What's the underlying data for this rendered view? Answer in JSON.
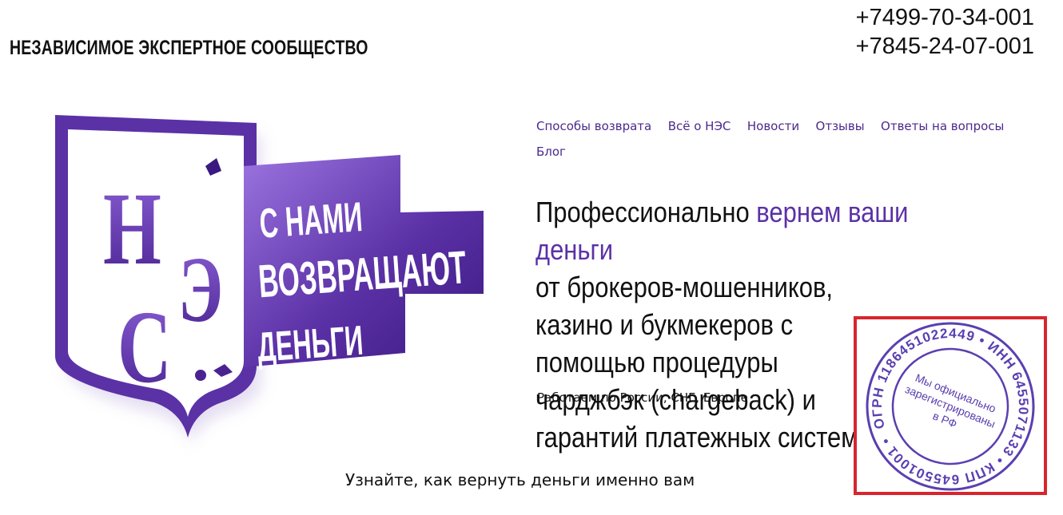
{
  "header": {
    "site_title": "НЕЗАВИСИМОЕ ЭКСПЕРТНОЕ СООБЩЕСТВО",
    "phones": [
      "+7499-70-34-001",
      "+7845-24-07-001"
    ]
  },
  "logo": {
    "monogram_letters": [
      "Н",
      "Э",
      "С"
    ],
    "slogan_lines": [
      "С НАМИ",
      "ВОЗВРАЩАЮТ",
      "ДЕНЬГИ"
    ],
    "colors": {
      "primary": "#5b31a6",
      "light": "#8a5fd6",
      "dark": "#3a1980"
    }
  },
  "nav": {
    "items": [
      {
        "label": "Способы возврата"
      },
      {
        "label": "Всё о НЭС"
      },
      {
        "label": "Новости"
      },
      {
        "label": "Отзывы"
      },
      {
        "label": "Ответы на вопросы"
      },
      {
        "label": "Блог"
      }
    ]
  },
  "hero": {
    "headline_start": "Профессионально ",
    "headline_accent": "вернем ваши деньги",
    "headline_rest": "от брокеров-мошенников, казино и букмекеров с помощью процедуры чарджбэк (chargeback) и гарантий платежных систем",
    "region": "Работаем по России, СНГ, Европе",
    "cta": "Узнайте, как вернуть деньги именно вам"
  },
  "stamp": {
    "ring_text": "ОГРН 1186451022449 • ИНН 6455071133 • КПП 645501001 •",
    "center_lines": [
      "Мы официально",
      "зарегистрированы",
      "в РФ"
    ],
    "ink_color": "#5b3fb0",
    "frame_color": "#d7262e"
  }
}
